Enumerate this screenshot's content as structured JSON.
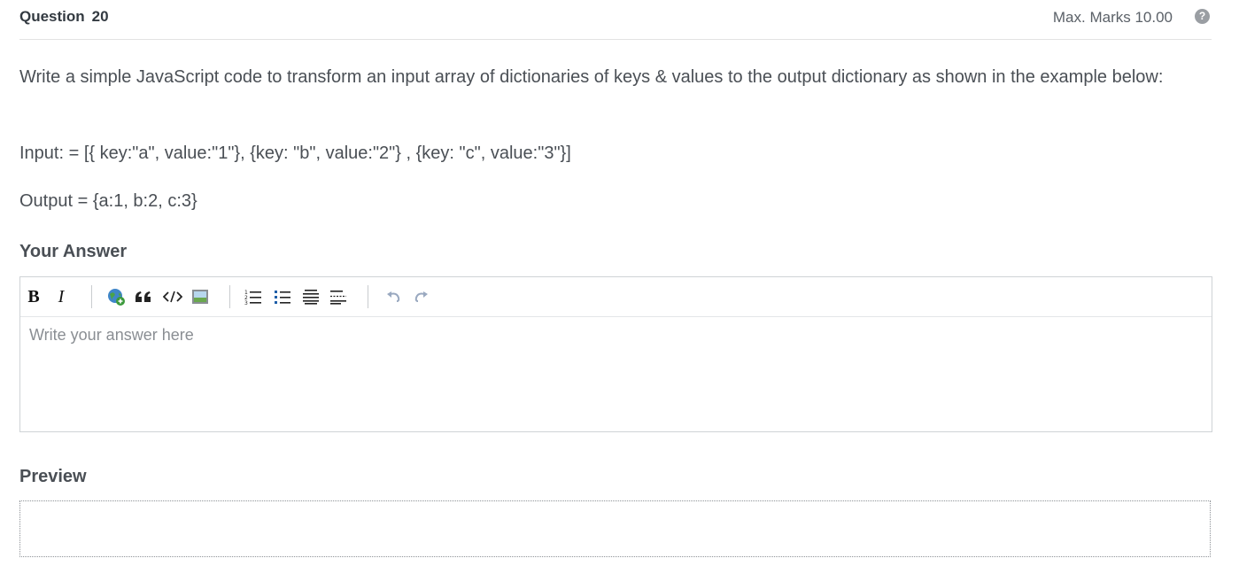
{
  "header": {
    "question_label": "Question",
    "question_number": "20",
    "max_marks": "Max. Marks 10.00",
    "help_icon": "question-circle-icon"
  },
  "question": {
    "text": "Write a simple JavaScript code to transform an input array of dictionaries of keys & values to the output dictionary as shown in the example below:",
    "input_line": "Input: = [{ key:\"a\", value:\"1\"}, {key: \"b\", value:\"2\"} , {key: \"c\", value:\"3\"}]",
    "output_line": "Output = {a:1, b:2, c:3}"
  },
  "answer": {
    "label": "Your Answer",
    "placeholder": "Write your answer here",
    "value": "",
    "toolbar": {
      "bold_label": "B",
      "italic_label": "I",
      "icons": [
        "bold-icon",
        "italic-icon",
        "link-icon",
        "quote-icon",
        "code-icon",
        "image-icon",
        "ordered-list-icon",
        "bulleted-list-icon",
        "heading-icon",
        "horizontal-rule-icon",
        "undo-icon",
        "redo-icon"
      ]
    }
  },
  "preview": {
    "label": "Preview"
  },
  "colors": {
    "text": "#4a4f55",
    "heading": "#333a41",
    "border": "#cfd3d6",
    "help_icon_bg": "#9a9ea3"
  }
}
